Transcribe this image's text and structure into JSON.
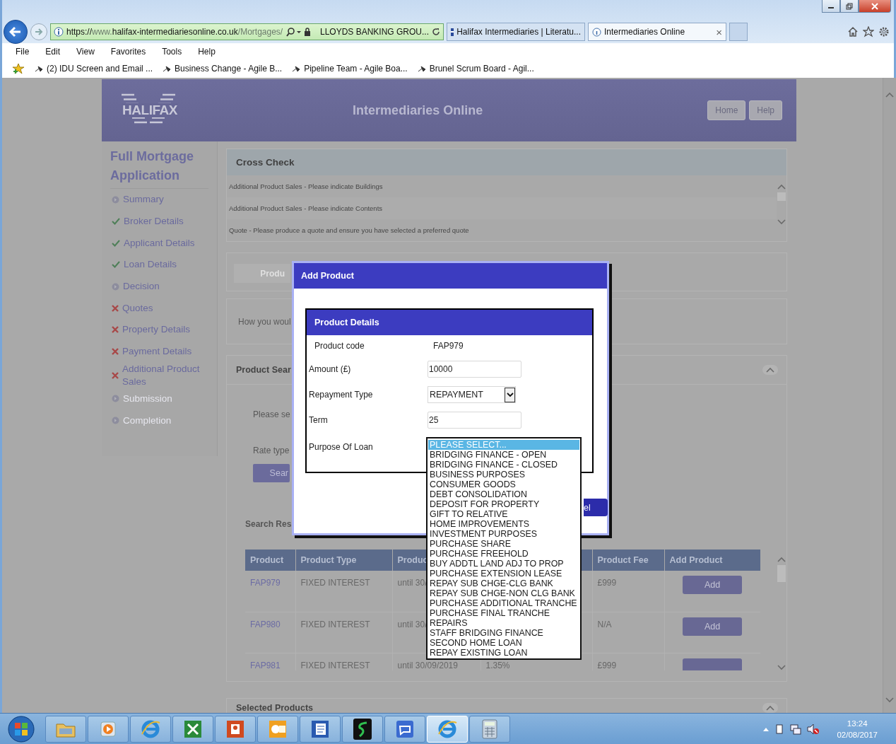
{
  "browser": {
    "address": {
      "url": [
        {
          "text": "https://",
          "dim": false
        },
        {
          "text": "www.",
          "dim": true
        },
        {
          "text": "halifax-intermediariesonline.co.uk",
          "dim": false
        },
        {
          "text": "/Mortgages/",
          "dim": true
        }
      ],
      "certificate": "LLOYDS BANKING GROU..."
    },
    "tabs": [
      {
        "title": "Halifax Intermediaries | Literatu...",
        "selected": false
      },
      {
        "title": "Intermediaries Online",
        "selected": true
      }
    ],
    "close_glyph": "×",
    "menu": [
      "File",
      "Edit",
      "View",
      "Favorites",
      "Tools",
      "Help"
    ],
    "favorites": [
      "(2) IDU Screen and Email ...",
      "Business Change - Agile B...",
      "Pipeline Team - Agile Boa...",
      "Brunel Scrum Board - Agil..."
    ]
  },
  "site": {
    "logo": "HALIFAX",
    "title": "Intermediaries Online",
    "buttons": [
      "Home",
      "Help"
    ]
  },
  "sidebar": {
    "title": "Full Mortgage Application",
    "items": [
      {
        "label": "Summary",
        "kind": "pending",
        "disabled": false
      },
      {
        "label": "Broker Details",
        "kind": "done",
        "disabled": false
      },
      {
        "label": "Applicant Details",
        "kind": "done",
        "disabled": false
      },
      {
        "label": "Loan Details",
        "kind": "done",
        "disabled": false
      },
      {
        "label": "Decision",
        "kind": "pending",
        "disabled": false
      },
      {
        "label": "Quotes",
        "kind": "error",
        "disabled": false
      },
      {
        "label": "Property Details",
        "kind": "error",
        "disabled": false
      },
      {
        "label": "Payment Details",
        "kind": "error",
        "disabled": false
      },
      {
        "label": "Additional Product Sales",
        "kind": "error",
        "disabled": false
      },
      {
        "label": "Submission",
        "kind": "pending",
        "disabled": true
      },
      {
        "label": "Completion",
        "kind": "pending",
        "disabled": true
      }
    ]
  },
  "cross_check": {
    "title": "Cross Check",
    "messages": [
      "Additional Product Sales - Please indicate Buildings",
      "Additional Product Sales - Please indicate Contents",
      "Quote - Please produce a quote and ensure you have selected a preferred quote"
    ]
  },
  "product_tab": {
    "label": "Produ"
  },
  "question": "How you woul",
  "product_search": {
    "title": "Product Sear",
    "prompt": "Please se",
    "rate_label": "Rate type",
    "search_button": "Sear",
    "results_title": "Search Res",
    "columns": [
      {
        "kind": "label",
        "label": "Product"
      },
      {
        "kind": "label",
        "label": "Product Type"
      },
      {
        "kind": "label",
        "label": "Produc"
      },
      {
        "kind": "covered"
      },
      {
        "kind": "label",
        "label": "Product Fee"
      },
      {
        "kind": "label",
        "label": "Add Product"
      }
    ],
    "rows": [
      {
        "product": "FAP979",
        "product_type": "FIXED INTEREST",
        "column_3": "until 30/",
        "product_fee": "£999",
        "action": "Add"
      },
      {
        "product": "FAP980",
        "product_type": "FIXED INTEREST",
        "column_3": "until 30/",
        "product_fee": "N/A",
        "action": "Add"
      },
      {
        "product": "FAP981",
        "product_type": "FIXED INTEREST",
        "column_3": "until 30/09/2019",
        "column_4": "1.35%",
        "product_fee": "£999"
      }
    ]
  },
  "selected_products": {
    "title": "Selected Products"
  },
  "dialog": {
    "title": "Add Product",
    "panel_title": "Product Details",
    "fields": [
      {
        "kind": "static",
        "label": "Product code",
        "value": "FAP979"
      },
      {
        "kind": "input",
        "label": "Amount (£)",
        "value": "10000"
      },
      {
        "kind": "select",
        "label": "Repayment Type",
        "value": "REPAYMENT"
      },
      {
        "kind": "input",
        "label": "Term",
        "value": "25"
      },
      {
        "kind": "list",
        "label": "Purpose Of Loan"
      }
    ],
    "cancel_button": "el",
    "purpose_options": [
      {
        "label": "PLEASE SELECT...",
        "selected": true
      },
      {
        "label": "BRIDGING FINANCE - OPEN",
        "selected": false
      },
      {
        "label": "BRIDGING FINANCE - CLOSED",
        "selected": false
      },
      {
        "label": "BUSINESS PURPOSES",
        "selected": false
      },
      {
        "label": "CONSUMER GOODS",
        "selected": false
      },
      {
        "label": "DEBT CONSOLIDATION",
        "selected": false
      },
      {
        "label": "DEPOSIT FOR PROPERTY",
        "selected": false
      },
      {
        "label": "GIFT TO RELATIVE",
        "selected": false
      },
      {
        "label": "HOME IMPROVEMENTS",
        "selected": false
      },
      {
        "label": "INVESTMENT PURPOSES",
        "selected": false
      },
      {
        "label": "PURCHASE SHARE",
        "selected": false
      },
      {
        "label": "PURCHASE FREEHOLD",
        "selected": false
      },
      {
        "label": "BUY ADDTL LAND ADJ TO PROP",
        "selected": false
      },
      {
        "label": "PURCHASE EXTENSION LEASE",
        "selected": false
      },
      {
        "label": "REPAY SUB CHGE-CLG BANK",
        "selected": false
      },
      {
        "label": "REPAY SUB CHGE-NON CLG BANK",
        "selected": false
      },
      {
        "label": "PURCHASE ADDITIONAL TRANCHE",
        "selected": false
      },
      {
        "label": "PURCHASE FINAL TRANCHE",
        "selected": false
      },
      {
        "label": "REPAIRS",
        "selected": false
      },
      {
        "label": "STAFF BRIDGING FINANCE",
        "selected": false
      },
      {
        "label": "SECOND HOME LOAN",
        "selected": false
      },
      {
        "label": "REPAY EXISTING LOAN",
        "selected": false
      }
    ]
  },
  "taskbar": {
    "items": [
      {
        "kind": "folder",
        "active": false
      },
      {
        "kind": "player",
        "active": false
      },
      {
        "kind": "browser",
        "active": false
      },
      {
        "kind": "sheet",
        "active": false
      },
      {
        "kind": "slides",
        "active": false
      },
      {
        "kind": "mail",
        "active": false
      },
      {
        "kind": "doc",
        "active": false
      },
      {
        "kind": "scurve",
        "active": false
      },
      {
        "kind": "chat",
        "active": false
      },
      {
        "kind": "browser",
        "active": true
      },
      {
        "kind": "calc",
        "active": false
      }
    ],
    "time": "13:24",
    "date": "02/08/2017"
  }
}
